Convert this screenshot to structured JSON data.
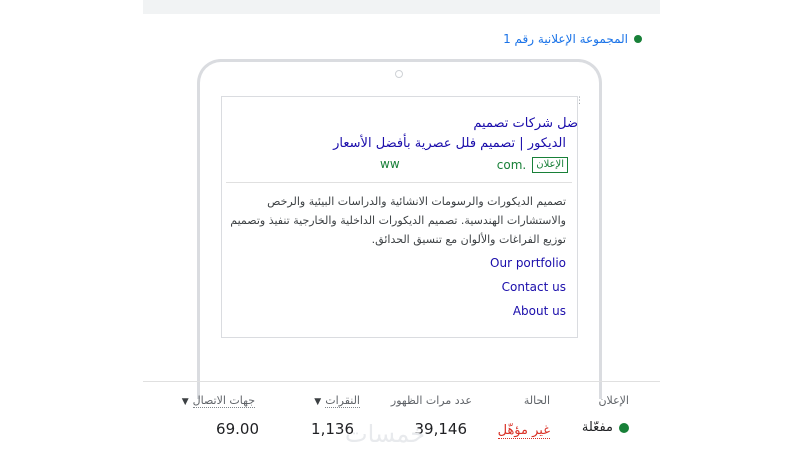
{
  "adgroup": {
    "label": "المجموعة الإعلانية رقم 1"
  },
  "ad": {
    "headline1": "ضل شركات تصميم",
    "headline2": "الديكور | تصميم فلل عصرية بأفضل الأسعار",
    "ad_badge": "الإعلان",
    "display_url": "ww",
    "url_suffix": ".com",
    "description": "تصميم الديكورات والرسومات الانشائية والدراسات البيئية والرخص والاستشارات الهندسية. تصميم الديكورات الداخلية والخارجية تنفيذ وتصميم توزيع الفراغات والألوان مع تنسيق الحدائق.",
    "sitelinks": [
      "Our portfolio",
      "Contact us",
      "About us"
    ]
  },
  "table": {
    "headers": {
      "ad": "الإعلان",
      "status": "الحالة",
      "impressions": "عدد مرات الظهور",
      "clicks": "النقرات",
      "conversions": "جهات الاتصال"
    },
    "row": {
      "ad_status": "مفعّلة",
      "status": "غير مؤهّل",
      "impressions": "39,146",
      "clicks": "1,136",
      "conversions": "69.00"
    }
  },
  "watermark": "خمسات",
  "colors": {
    "link": "#1a0dab",
    "green": "#188038",
    "red": "#d93025",
    "accent": "#1a73e8"
  }
}
